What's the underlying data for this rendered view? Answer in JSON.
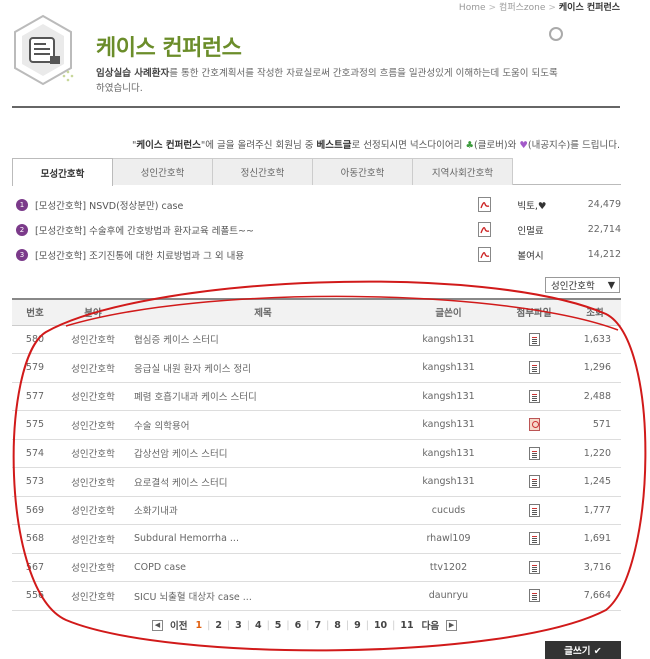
{
  "breadcrumb": [
    "Home",
    "컴퍼스zone",
    "케이스 컨퍼런스"
  ],
  "header": {
    "title": "케이스 컨퍼런스",
    "desc_bold": "임상실습 사례환자",
    "desc_rest": "를 통한 간호계획서를 작성한 자료실로써 간호과정의 흐름을 일관성있게 이해하는데 도움이 되도록 하였습니다."
  },
  "notice": {
    "part1": "\"",
    "bold1": "케이스 컨퍼런스",
    "part2": "\"에 글을 올려주신 회원님 중 ",
    "bold2": "베스트글",
    "part3": "로 선정되시면 넉스다이어리 ",
    "part4": "(클로버)와 ",
    "part5": "(내공지수)를 드립니다."
  },
  "tabs": [
    "모성간호학",
    "성인간호학",
    "정신간호학",
    "아동간호학",
    "지역사회간호학"
  ],
  "best": [
    {
      "rank": "1",
      "title": "[모성간호학] NSVD(정상분만) case",
      "author": "빅토,♥",
      "views": "24,479"
    },
    {
      "rank": "2",
      "title": "[모성간호학] 수술후에 간호방법과 환자교육 레폴트~~",
      "author": "인멀료",
      "views": "22,714"
    },
    {
      "rank": "3",
      "title": "[모성간호학] 조기진통에 대한 치료방법과 그 외 내용",
      "author": "볼여시",
      "views": "14,212"
    }
  ],
  "filter": {
    "selected": "성인간호학"
  },
  "table": {
    "headers": [
      "번호",
      "분야",
      "제목",
      "글쓴이",
      "첨부파일",
      "조회"
    ],
    "rows": [
      {
        "num": "580",
        "cat": "성인간호학",
        "title": "협심증 케이스 스터디",
        "author": "kangsh131",
        "views": "1,633"
      },
      {
        "num": "579",
        "cat": "성인간호학",
        "title": "응급실 내원 환자 케이스 정리",
        "author": "kangsh131",
        "views": "1,296"
      },
      {
        "num": "577",
        "cat": "성인간호학",
        "title": "폐렴 호흡기내과 케이스 스터디",
        "author": "kangsh131",
        "views": "2,488"
      },
      {
        "num": "575",
        "cat": "성인간호학",
        "title": "수술 의학용어",
        "author": "kangsh131",
        "views": "571"
      },
      {
        "num": "574",
        "cat": "성인간호학",
        "title": "갑상선암 케이스 스터디",
        "author": "kangsh131",
        "views": "1,220"
      },
      {
        "num": "573",
        "cat": "성인간호학",
        "title": "요로결석 케이스 스터디",
        "author": "kangsh131",
        "views": "1,245"
      },
      {
        "num": "569",
        "cat": "성인간호학",
        "title": "소화기내과",
        "author": "cucuds",
        "views": "1,777"
      },
      {
        "num": "568",
        "cat": "성인간호학",
        "title": "Subdural Hemorrha ...",
        "author": "rhawl109",
        "views": "1,691"
      },
      {
        "num": "567",
        "cat": "성인간호학",
        "title": "COPD case",
        "author": "ttv1202",
        "views": "3,716"
      },
      {
        "num": "556",
        "cat": "성인간호학",
        "title": "SICU 뇌출혈 대상자 case ...",
        "author": "daunryu",
        "views": "7,664"
      }
    ]
  },
  "pager": {
    "prev": "이전",
    "next": "다음",
    "pages": [
      "1",
      "2",
      "3",
      "4",
      "5",
      "6",
      "7",
      "8",
      "9",
      "10",
      "11"
    ],
    "current": "1"
  },
  "write_button": "글쓰기 ✔",
  "colors": {
    "accent": "#6b8d2a",
    "rank": "#7b3a8a",
    "current_page": "#e06010",
    "annotation": "#d11a1a"
  }
}
